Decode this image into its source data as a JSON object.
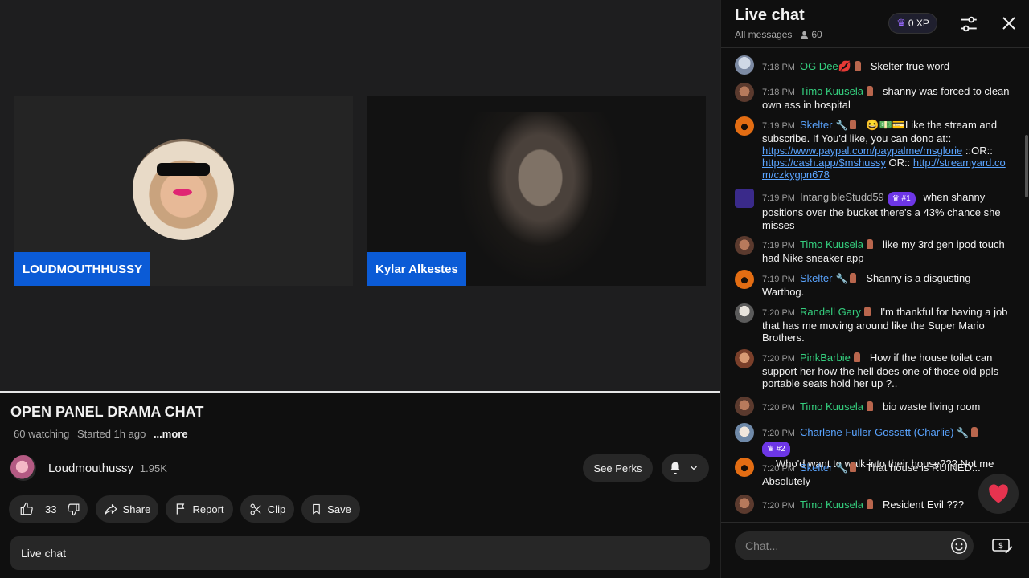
{
  "stream": {
    "title": "OPEN PANEL DRAMA CHAT",
    "watching": "60 watching",
    "started": "Started 1h ago",
    "more": "...more",
    "tiles": [
      {
        "name": "LOUDMOUTHHUSSY"
      },
      {
        "name": "Kylar Alkestes"
      }
    ]
  },
  "channel": {
    "name": "Loudmouthussy",
    "subscribers": "1.95K",
    "see_perks": "See Perks"
  },
  "actions": {
    "like_count": "33",
    "share": "Share",
    "report": "Report",
    "clip": "Clip",
    "save": "Save"
  },
  "collapsed_chat_label": "Live chat",
  "chat": {
    "title": "Live chat",
    "filter": "All messages",
    "viewers": "60",
    "xp": "0 XP",
    "input_placeholder": "Chat...",
    "messages": [
      {
        "time": "7:18 PM",
        "author": "OG Dee💋",
        "text": "Skelter true word"
      },
      {
        "time": "7:18 PM",
        "author": "Timo Kuusela",
        "text": "shanny was forced to clean own ass in hospital"
      },
      {
        "time": "7:19 PM",
        "author": "Skelter",
        "text": "😆💵💳Like the stream and subscribe. If You'd like, you can dono at::",
        "link1": "https://www.paypal.com/paypalme/msglorie",
        "sep1": " ::OR::",
        "link2": "https://cash.app/$mshussy",
        "sep2": " OR:: ",
        "link3": "http://streamyard.com/czkygpn678"
      },
      {
        "time": "7:19 PM",
        "author": "IntangibleStudd59",
        "rank": "#1",
        "text": "when shanny positions over the bucket there's a 43% chance she misses"
      },
      {
        "time": "7:19 PM",
        "author": "Timo Kuusela",
        "text": "like my 3rd gen ipod touch had Nike sneaker app"
      },
      {
        "time": "7:19 PM",
        "author": "Skelter",
        "text": "Shanny is a disgusting Warthog."
      },
      {
        "time": "7:20 PM",
        "author": "Randell Gary",
        "text": "I'm thankful for having a job that has me moving around like the Super Mario Brothers."
      },
      {
        "time": "7:20 PM",
        "author": "PinkBarbie",
        "text": "How if the house toilet can support her how the hell does one of those old ppls portable seats hold her up ?.."
      },
      {
        "time": "7:20 PM",
        "author": "Timo Kuusela",
        "text": "bio waste living room"
      },
      {
        "time": "7:20 PM",
        "author": "Charlene Fuller-Gossett (Charlie)",
        "rank": "#2",
        "text": "Who'd want to walk into their house??? Not me"
      },
      {
        "time": "7:20 PM",
        "author": "Skelter",
        "text": "That house is RUINED... Absolutely"
      },
      {
        "time": "7:20 PM",
        "author": "Timo Kuusela",
        "text": "Resident Evil ???"
      }
    ]
  },
  "colors": {
    "background": "#0f0f0f",
    "pill": "#272727",
    "name_tag": "#0b5bd6",
    "green_author": "#35d07f",
    "blue_author": "#5aa4ff",
    "rank_badge": "#6d36e6",
    "heart": "#e6334f"
  }
}
